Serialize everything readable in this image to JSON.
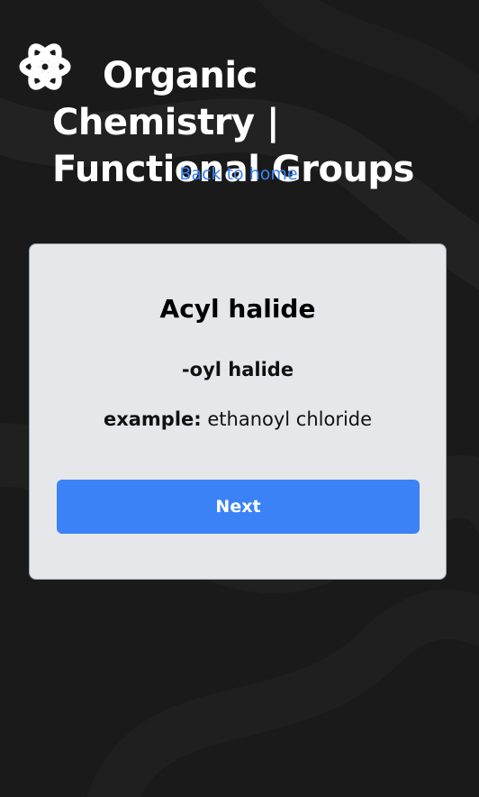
{
  "header": {
    "logo_icon": "atom-icon",
    "title": "Organic Chemistry | Functional Groups",
    "back_link_label": "Back to home"
  },
  "card": {
    "group_name": "Acyl halide",
    "suffix": "-oyl halide",
    "example_label": "example:",
    "example_value": "ethanoyl chloride",
    "next_label": "Next"
  },
  "colors": {
    "background": "#1a1a1a",
    "card_background": "#e5e7eb",
    "accent": "#3b82f6",
    "text_light": "#ffffff",
    "text_dark": "#111111"
  }
}
